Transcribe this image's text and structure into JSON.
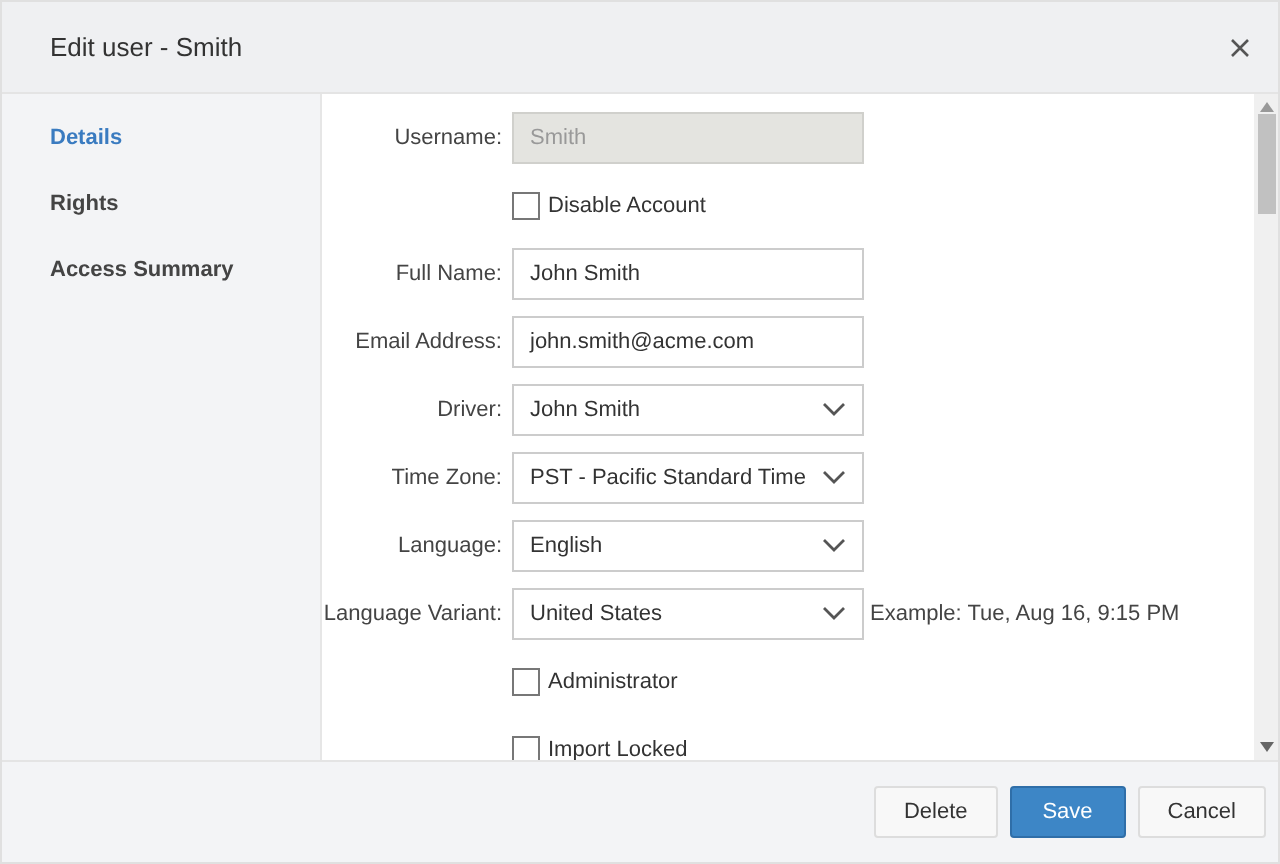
{
  "dialog": {
    "title": "Edit user - Smith"
  },
  "sidebar": {
    "items": [
      {
        "label": "Details",
        "selected": true
      },
      {
        "label": "Rights",
        "selected": false
      },
      {
        "label": "Access Summary",
        "selected": false
      }
    ]
  },
  "form": {
    "rows": [
      {
        "kind": "text",
        "label": "Username:",
        "value": "Smith",
        "disabled": true
      },
      {
        "kind": "checkbox",
        "label": "Disable Account",
        "checked": false
      },
      {
        "kind": "text",
        "label": "Full Name:",
        "value": "John Smith",
        "disabled": false
      },
      {
        "kind": "text",
        "label": "Email Address:",
        "value": "john.smith@acme.com",
        "disabled": false
      },
      {
        "kind": "select",
        "label": "Driver:",
        "value": "John Smith"
      },
      {
        "kind": "select",
        "label": "Time Zone:",
        "value": "PST - Pacific Standard Time"
      },
      {
        "kind": "select",
        "label": "Language:",
        "value": "English"
      },
      {
        "kind": "select",
        "label": "Language Variant:",
        "value": "United States",
        "note": "Example: Tue, Aug 16, 9:15 PM"
      },
      {
        "kind": "checkbox",
        "label": "Administrator",
        "checked": false
      },
      {
        "kind": "checkbox",
        "label": "Import Locked",
        "checked": false
      }
    ]
  },
  "buttons": [
    {
      "label": "Delete",
      "kind": "default"
    },
    {
      "label": "Save",
      "kind": "primary"
    },
    {
      "label": "Cancel",
      "kind": "default"
    }
  ]
}
